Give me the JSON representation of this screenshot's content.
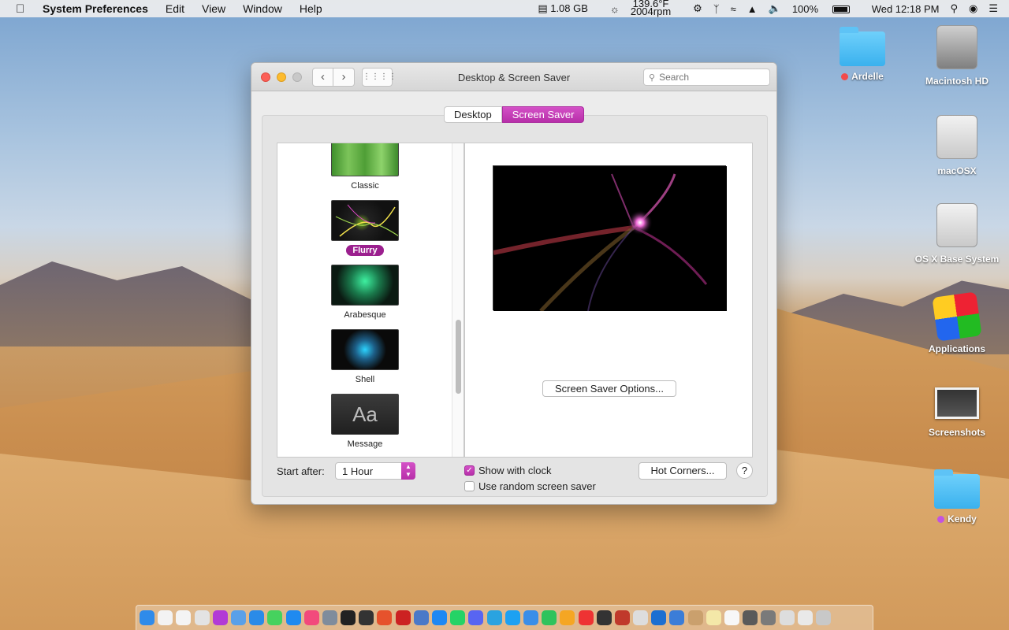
{
  "menubar": {
    "app_name": "System Preferences",
    "menus": [
      "Edit",
      "View",
      "Window",
      "Help"
    ],
    "memory": "1.08 GB",
    "temp_line1": "139.6°F",
    "temp_line2": "2004rpm",
    "battery": "100%",
    "datetime": "Wed 12:18 PM"
  },
  "window": {
    "title": "Desktop & Screen Saver",
    "search_placeholder": "Search",
    "tabs": [
      "Desktop",
      "Screen Saver"
    ],
    "active_tab": "Screen Saver",
    "savers": [
      {
        "label": "Classic"
      },
      {
        "label": "Flurry",
        "selected": true
      },
      {
        "label": "Arabesque"
      },
      {
        "label": "Shell"
      },
      {
        "label": "Message",
        "thumb_text": "Aa"
      }
    ],
    "options_button": "Screen Saver Options...",
    "start_after_label": "Start after:",
    "start_after_value": "1 Hour",
    "show_with_clock": "Show with clock",
    "show_with_clock_checked": true,
    "random_saver": "Use random screen saver",
    "random_saver_checked": false,
    "hot_corners_button": "Hot Corners...",
    "help_button": "?"
  },
  "desktop": {
    "icons": [
      {
        "label": "Ardelle",
        "type": "folder",
        "tag_color": "#f24b4b"
      },
      {
        "label": "Macintosh HD",
        "type": "hard-drive"
      },
      {
        "label": "macOSX",
        "type": "drive"
      },
      {
        "label": "OS X Base System",
        "type": "drive"
      },
      {
        "label": "Applications",
        "type": "applications"
      },
      {
        "label": "Screenshots",
        "type": "screenshots"
      },
      {
        "label": "Kendy",
        "type": "folder",
        "tag_color": "#c354e0"
      }
    ]
  },
  "dock": {
    "colors": [
      "#2f8bea",
      "#f3f3f3",
      "#f4f4f4",
      "#e3e3e3",
      "#b23ad6",
      "#5aa0e8",
      "#2a8be8",
      "#46d25e",
      "#1f8af0",
      "#f24a7c",
      "#7f8c9c",
      "#222",
      "#333",
      "#e6522c",
      "#c22",
      "#4a79c8",
      "#1e88f3",
      "#25d366",
      "#5865f2",
      "#2aa3e0",
      "#1da1f2",
      "#3a8ee8",
      "#2fc35c",
      "#f5a623",
      "#e33",
      "#333",
      "#c0392b",
      "#ddd",
      "#1c6fd1",
      "#3b7dd8",
      "#caa06d",
      "#f4e8a8",
      "#f7f7f7",
      "#5a5a5a",
      "#7a7a7a",
      "#ddd",
      "#e9e9e9",
      "#c8c8c8"
    ]
  }
}
